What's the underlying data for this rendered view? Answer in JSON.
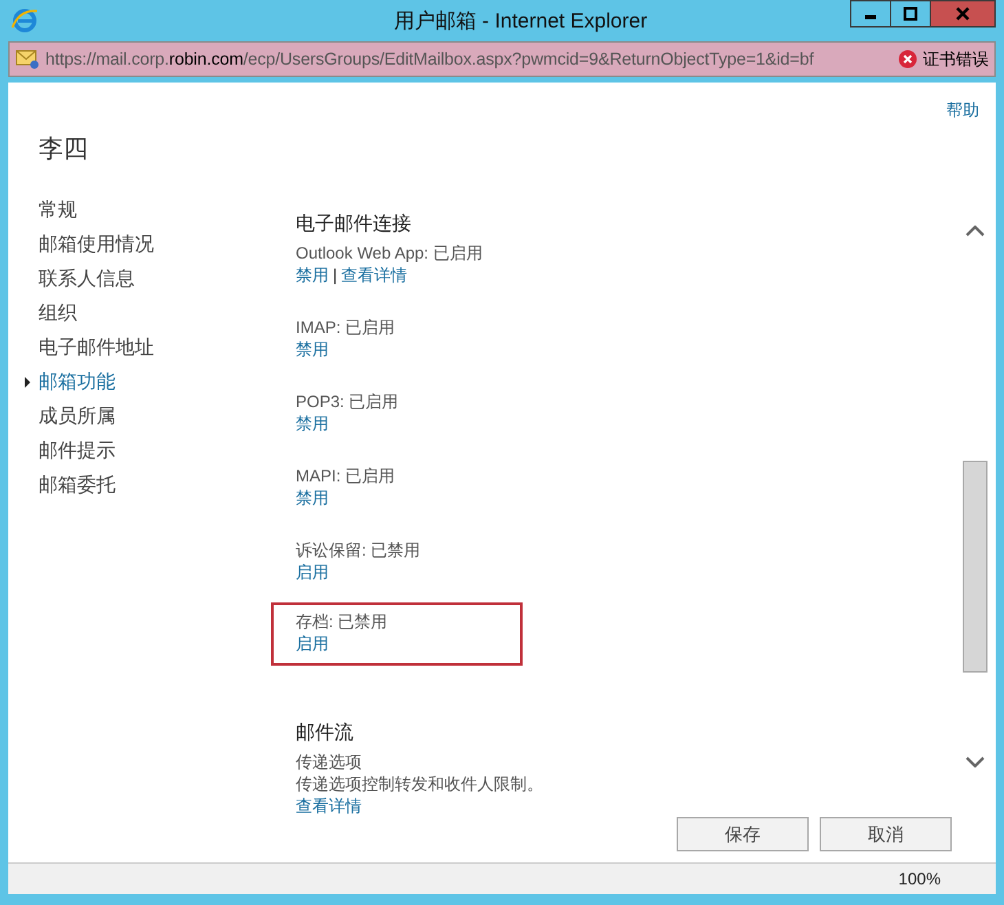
{
  "window": {
    "title": "用户邮箱 - Internet Explorer"
  },
  "address_bar": {
    "url": "https://mail.corp.**robin.com**/ecp/UsersGroups/EditMailbox.aspx?pwmcid=9&ReturnObjectType=1&id=bf",
    "certificate_error": "证书错误"
  },
  "help": "帮助",
  "user_name": "李四",
  "nav": [
    {
      "label": "常规",
      "selected": false
    },
    {
      "label": "邮箱使用情况",
      "selected": false
    },
    {
      "label": "联系人信息",
      "selected": false
    },
    {
      "label": "组织",
      "selected": false
    },
    {
      "label": "电子邮件地址",
      "selected": false
    },
    {
      "label": "邮箱功能",
      "selected": true
    },
    {
      "label": "成员所属",
      "selected": false
    },
    {
      "label": "邮件提示",
      "selected": false
    },
    {
      "label": "邮箱委托",
      "selected": false
    }
  ],
  "sections": [
    {
      "title": "电子邮件连接",
      "features": [
        {
          "status": "Outlook Web App: 已启用",
          "links": [
            "禁用",
            "查看详情"
          ],
          "separator": "|",
          "highlighted": false
        },
        {
          "status": "IMAP: 已启用",
          "links": [
            "禁用"
          ],
          "highlighted": false
        },
        {
          "status": "POP3: 已启用",
          "links": [
            "禁用"
          ],
          "highlighted": false
        },
        {
          "status": "MAPI: 已启用",
          "links": [
            "禁用"
          ],
          "highlighted": false
        },
        {
          "status": "诉讼保留: 已禁用",
          "links": [
            "启用"
          ],
          "highlighted": false
        },
        {
          "status": "存档: 已禁用",
          "links": [
            "启用"
          ],
          "highlighted": true
        }
      ]
    },
    {
      "title": "邮件流",
      "features": [
        {
          "status": "传递选项",
          "description": "传递选项控制转发和收件人限制。",
          "links": [
            "查看详情"
          ],
          "highlighted": false
        }
      ]
    }
  ],
  "buttons": [
    "保存",
    "取消"
  ],
  "status_bar": {
    "zoom": "100%"
  }
}
